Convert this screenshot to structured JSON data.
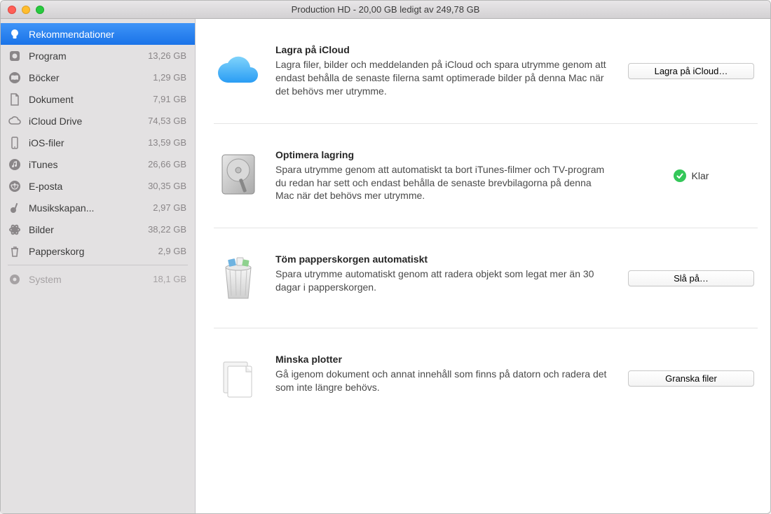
{
  "window": {
    "title": "Production HD - 20,00 GB ledigt av 249,78 GB"
  },
  "sidebar": {
    "items": [
      {
        "label": "Rekommendationer",
        "size": "",
        "icon": "lightbulb",
        "selected": true
      },
      {
        "label": "Program",
        "size": "13,26 GB",
        "icon": "app"
      },
      {
        "label": "Böcker",
        "size": "1,29 GB",
        "icon": "book"
      },
      {
        "label": "Dokument",
        "size": "7,91 GB",
        "icon": "document"
      },
      {
        "label": "iCloud Drive",
        "size": "74,53 GB",
        "icon": "cloud"
      },
      {
        "label": "iOS-filer",
        "size": "13,59 GB",
        "icon": "phone"
      },
      {
        "label": "iTunes",
        "size": "26,66 GB",
        "icon": "music-note"
      },
      {
        "label": "E-posta",
        "size": "30,35 GB",
        "icon": "mail"
      },
      {
        "label": "Musikskapan...",
        "size": "2,97 GB",
        "icon": "guitar"
      },
      {
        "label": "Bilder",
        "size": "38,22 GB",
        "icon": "photos"
      },
      {
        "label": "Papperskorg",
        "size": "2,9 GB",
        "icon": "trash"
      }
    ],
    "system": {
      "label": "System",
      "size": "18,1 GB",
      "icon": "gear"
    }
  },
  "recommendations": [
    {
      "title": "Lagra på iCloud",
      "desc": "Lagra filer, bilder och meddelanden på iCloud och spara utrymme genom att endast behålla de senaste filerna samt optimerade bilder på denna Mac när det behövs mer utrymme.",
      "action_type": "button",
      "action_label": "Lagra på iCloud…",
      "icon": "icloud"
    },
    {
      "title": "Optimera lagring",
      "desc": "Spara utrymme genom att automatiskt ta bort iTunes-filmer och TV-program du redan har sett och endast behålla de senaste brevbilagorna på denna Mac när det behövs mer utrymme.",
      "action_type": "done",
      "action_label": "Klar",
      "icon": "hdd"
    },
    {
      "title": "Töm papperskorgen automatiskt",
      "desc": "Spara utrymme automatiskt genom att radera objekt som legat mer än 30 dagar i papperskorgen.",
      "action_type": "button",
      "action_label": "Slå på…",
      "icon": "trash-full"
    },
    {
      "title": "Minska plotter",
      "desc": "Gå igenom dokument och annat innehåll som finns på datorn och radera det som inte längre behövs.",
      "action_type": "button",
      "action_label": "Granska filer",
      "icon": "stack"
    }
  ]
}
